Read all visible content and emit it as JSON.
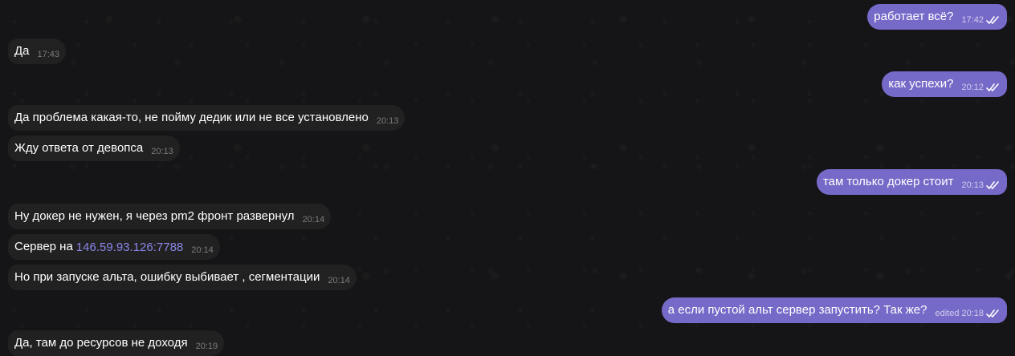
{
  "messages": [
    {
      "id": "m1",
      "direction": "out",
      "text": "работает всё?",
      "time": "17:42",
      "read": true
    },
    {
      "id": "m2",
      "direction": "in",
      "text": "Да",
      "time": "17:43"
    },
    {
      "id": "m3",
      "direction": "out",
      "text": "как успехи?",
      "time": "20:12",
      "read": true
    },
    {
      "id": "m4",
      "direction": "in",
      "text": "Да проблема какая-то, не пойму дедик или не все установлено",
      "time": "20:13"
    },
    {
      "id": "m5",
      "direction": "in",
      "text": "Жду ответа от девопса",
      "time": "20:13"
    },
    {
      "id": "m6",
      "direction": "out",
      "text": "там только докер стоит",
      "time": "20:13",
      "read": true
    },
    {
      "id": "m7",
      "direction": "in",
      "text": "Ну докер не нужен, я через pm2 фронт развернул",
      "time": "20:14"
    },
    {
      "id": "m8",
      "direction": "in",
      "text": "Сервер на",
      "link": "146.59.93.126:7788",
      "time": "20:14"
    },
    {
      "id": "m9",
      "direction": "in",
      "text": "Но при запуске альта, ошибку выбивает , сегментации",
      "time": "20:14"
    },
    {
      "id": "m10",
      "direction": "out",
      "text": "а если пустой альт сервер запустить? Так же?",
      "edited": "edited",
      "time": "20:18",
      "read": true
    },
    {
      "id": "m11",
      "direction": "in",
      "text": "Да, там до ресурсов не доходя",
      "time": "20:19"
    }
  ],
  "colors": {
    "background": "#151517",
    "incoming_bubble": "#212121",
    "outgoing_bubble": "#766ac8",
    "link": "#8b85e8"
  }
}
